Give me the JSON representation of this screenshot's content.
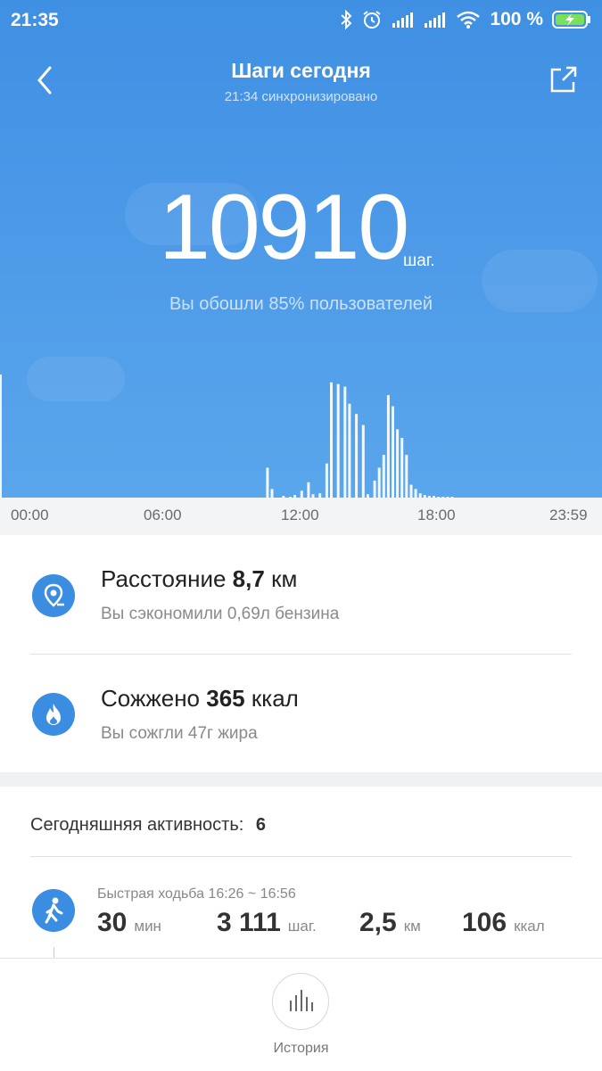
{
  "status": {
    "time": "21:35",
    "battery": "100 %"
  },
  "header": {
    "title": "Шаги сегодня",
    "subtitle": "21:34 синхронизировано"
  },
  "steps": {
    "value": "10910",
    "unit": "шаг.",
    "comparison": "Вы обошли 85% пользователей"
  },
  "chart_data": {
    "type": "bar",
    "x_ticks": [
      "00:00",
      "06:00",
      "12:00",
      "18:00",
      "23:59"
    ],
    "bars_hour": [
      10.5,
      10.7,
      11.2,
      11.5,
      11.7,
      12.0,
      12.3,
      12.5,
      12.8,
      13.1,
      13.3,
      13.6,
      13.9,
      14.1,
      14.4,
      14.7,
      14.9,
      15.2,
      15.4,
      15.6,
      15.8,
      16.0,
      16.2,
      16.4,
      16.6,
      16.8,
      17.0,
      17.2,
      17.4,
      17.6,
      17.8,
      18.0,
      18.2,
      18.4,
      18.6
    ],
    "bars_value": [
      35,
      10,
      2,
      1,
      3,
      8,
      18,
      4,
      5,
      40,
      135,
      133,
      130,
      110,
      98,
      85,
      4,
      20,
      35,
      50,
      120,
      107,
      80,
      70,
      50,
      15,
      10,
      5,
      3,
      2,
      2,
      1,
      1,
      1,
      1
    ]
  },
  "distance": {
    "label": "Расстояние",
    "value": "8,7",
    "unit": "км",
    "note": "Вы сэкономили 0,69л бензина"
  },
  "calories": {
    "label": "Сожжено",
    "value": "365",
    "unit": "ккал",
    "note": "Вы сожгли 47г жира"
  },
  "activity": {
    "header_label": "Сегодняшняя активность:",
    "count": "6",
    "item": {
      "type_time": "Быстрая ходьба 16:26 ~ 16:56",
      "duration": "30",
      "duration_unit": "мин",
      "steps": "3 111",
      "steps_unit": "шаг.",
      "distance": "2,5",
      "distance_unit": "км",
      "kcal": "106",
      "kcal_unit": "ккал"
    }
  },
  "bottom": {
    "history_label": "История"
  },
  "colors": {
    "accent": "#3b8de2",
    "hero_top": "#3f8fe3",
    "hero_bottom": "#5aa6ec"
  }
}
